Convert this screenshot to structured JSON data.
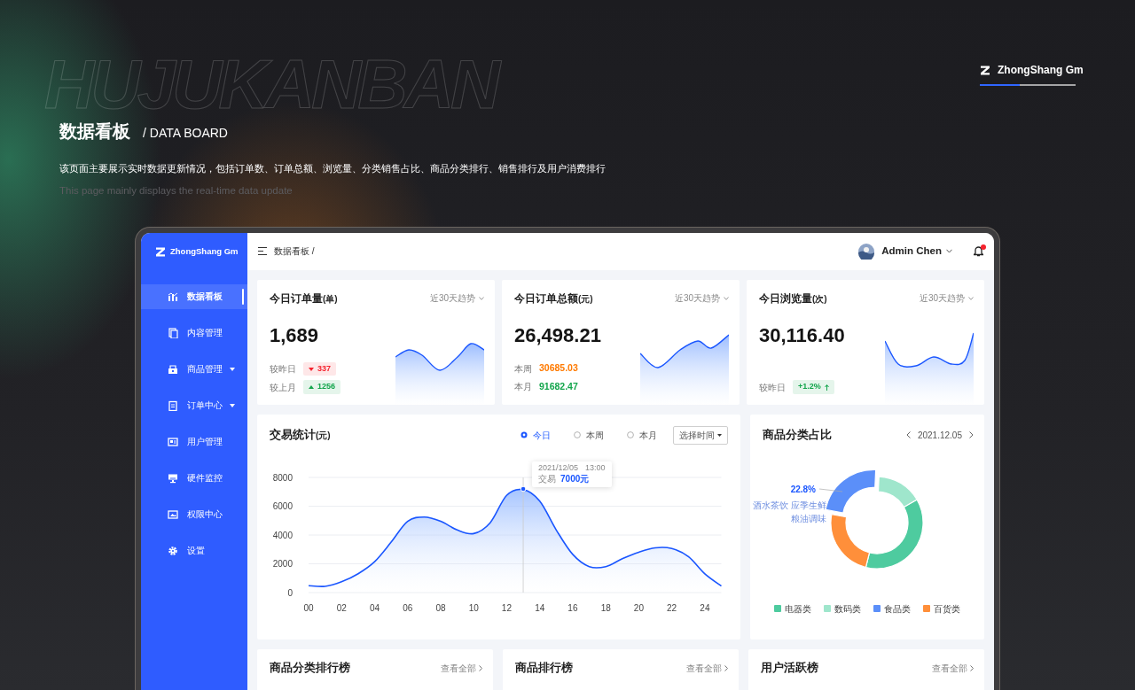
{
  "background_title": "HUJUKANBAN",
  "brand": {
    "name": "ZhongShang Gm"
  },
  "hero": {
    "title": "数据看板",
    "subtitle": "/ DATA BOARD",
    "description": "该页面主要展示实时数据更新情况，包括订单数、订单总额、浏览量、分类销售占比、商品分类排行、销售排行及用户消费排行",
    "description_en": "This page mainly displays the real-time data update"
  },
  "sidebar": {
    "brand": "ZhongShang Gm",
    "items": [
      {
        "label": "数据看板",
        "selected": true,
        "expandable": false
      },
      {
        "label": "内容管理",
        "selected": false,
        "expandable": false
      },
      {
        "label": "商品管理",
        "selected": false,
        "expandable": true
      },
      {
        "label": "订单中心",
        "selected": false,
        "expandable": true
      },
      {
        "label": "用户管理",
        "selected": false,
        "expandable": false
      },
      {
        "label": "硬件监控",
        "selected": false,
        "expandable": false
      },
      {
        "label": "权限中心",
        "selected": false,
        "expandable": false
      },
      {
        "label": "设置",
        "selected": false,
        "expandable": false
      }
    ]
  },
  "header": {
    "breadcrumb": "数据看板 /",
    "user": "Admin Chen",
    "unread": true
  },
  "stats": [
    {
      "title": "今日订单量",
      "unit": "(单)",
      "period": "近30天趋势",
      "value": "1,689",
      "rows": [
        {
          "label": "较昨日",
          "kind": "badge",
          "increase": false,
          "value": "337",
          "color": "#f5222d"
        },
        {
          "label": "较上月",
          "kind": "badge",
          "increase": true,
          "value": "1256",
          "color": "#13a54b"
        }
      ]
    },
    {
      "title": "今日订单总额",
      "unit": "(元)",
      "period": "近30天趋势",
      "value": "26,498.21",
      "rows": [
        {
          "label": "本周",
          "kind": "text",
          "value": "30685.03",
          "color": "#ff7a00"
        },
        {
          "label": "本月",
          "kind": "text",
          "value": "91682.47",
          "color": "#13a54b"
        }
      ]
    },
    {
      "title": "今日浏览量",
      "unit": "(次)",
      "period": "近30天趋势",
      "value": "30,116.40",
      "rows": [
        {
          "label": "较昨日",
          "kind": "badge-arrow",
          "increase": true,
          "value": "+1.2%",
          "color": "#13a54b"
        }
      ]
    }
  ],
  "trade": {
    "title": "交易统计",
    "unit": "(元)",
    "ranges": [
      {
        "label": "今日",
        "selected": true
      },
      {
        "label": "本周",
        "selected": false
      },
      {
        "label": "本月",
        "selected": false
      }
    ],
    "picker": "选择时间",
    "tooltip": {
      "date": "2021/12/05",
      "time": "13:00",
      "value": "7000元"
    },
    "chart_data": {
      "type": "area",
      "x": [
        0,
        1,
        2,
        3,
        4,
        5,
        6,
        7,
        8,
        9,
        10,
        11,
        12,
        13,
        14,
        15,
        16,
        17,
        18,
        19,
        20,
        21,
        22,
        23,
        24,
        25
      ],
      "series": [
        {
          "name": "交易",
          "color": "#1a56ff",
          "values": [
            530,
            480,
            800,
            1360,
            2200,
            3550,
            5000,
            5300,
            5000,
            4400,
            4150,
            4900,
            6800,
            7200,
            6400,
            4400,
            2700,
            1850,
            1850,
            2400,
            2850,
            3160,
            3110,
            2550,
            1350,
            500
          ]
        }
      ],
      "xlim": [
        0,
        25
      ],
      "ylim": [
        0,
        8000
      ],
      "xticks": [
        {
          "value": 0,
          "label": "00"
        },
        {
          "value": 2,
          "label": "02"
        },
        {
          "value": 4,
          "label": "04"
        },
        {
          "value": 6,
          "label": "06"
        },
        {
          "value": 8,
          "label": "08"
        },
        {
          "value": 10,
          "label": "10"
        },
        {
          "value": 12,
          "label": "12"
        },
        {
          "value": 14,
          "label": "14"
        },
        {
          "value": 16,
          "label": "16"
        },
        {
          "value": 18,
          "label": "18"
        },
        {
          "value": 20,
          "label": "20"
        },
        {
          "value": 22,
          "label": "22"
        },
        {
          "value": 24,
          "label": "24"
        }
      ],
      "yticks": [
        0,
        2000,
        4000,
        6000,
        8000
      ],
      "grid": true,
      "ref_lines": [
        {
          "axis": "x",
          "value": 13
        }
      ]
    }
  },
  "category_share": {
    "title": "商品分类占比",
    "date": "2021.12.05",
    "callout": {
      "lines": [
        "酒水茶饮 应季生鲜",
        "粮油调味"
      ]
    },
    "legend": [
      {
        "color": "#4ecb9f"
      },
      {
        "color": "#9fe6cc"
      },
      {
        "color": "#5b8ff9"
      },
      {
        "color": "#ff8f3a"
      }
    ],
    "chart_data": {
      "type": "donut",
      "categories": [
        "电器类",
        "数码类",
        "食品类",
        "百货类"
      ],
      "values": [
        37.2,
        16,
        22.8,
        24
      ],
      "annotations": [
        {
          "x": "食品类",
          "text": "22.8%"
        }
      ]
    }
  },
  "rankings": [
    {
      "title": "商品分类排行榜",
      "link": "查看全部"
    },
    {
      "title": "商品排行榜",
      "link": "查看全部"
    },
    {
      "title": "用户活跃榜",
      "link": "查看全部"
    }
  ]
}
